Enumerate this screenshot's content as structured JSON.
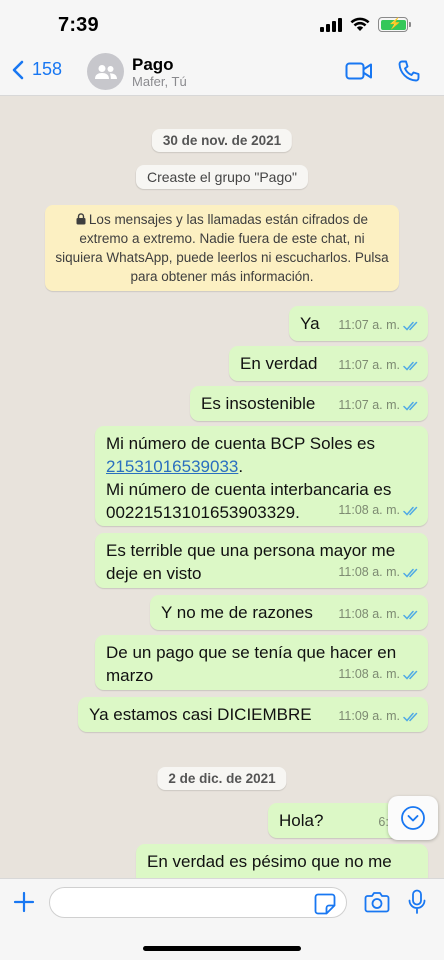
{
  "status": {
    "time": "7:39"
  },
  "header": {
    "back_count": "158",
    "title": "Pago",
    "subtitle": "Mafer, Tú"
  },
  "chat": {
    "date_1": "30 de nov. de 2021",
    "system_created": "Creaste el grupo \"Pago\"",
    "encryption_notice": "Los mensajes y las llamadas están cifrados de extremo a extremo. Nadie fuera de este chat, ni siquiera WhatsApp, puede leerlos ni escucharlos. Pulsa para obtener más información.",
    "messages": [
      {
        "text": "Ya",
        "time": "11:07 a. m."
      },
      {
        "text": "En verdad",
        "time": "11:07 a. m."
      },
      {
        "text": "Es insostenible",
        "time": "11:07 a. m."
      },
      {
        "line1": "Mi número de cuenta BCP Soles es",
        "link": "21531016539033",
        "line2_suffix": ".",
        "line3": "Mi número de cuenta interbancaria es",
        "line4": "00221513101653903329.",
        "time": "11:08 a. m."
      },
      {
        "text": "Es terrible que una persona mayor me deje en visto",
        "time": "11:08 a. m."
      },
      {
        "text": "Y no me de razones",
        "time": "11:08 a. m."
      },
      {
        "text": "De un pago que se tenía que hacer en marzo",
        "time": "11:08 a. m."
      },
      {
        "text": "Ya estamos casi DICIEMBRE",
        "time": "11:09 a. m."
      },
      {
        "text": "Hola?",
        "time": "6:13 p. m."
      },
      {
        "text": "En verdad es pésimo que no me",
        "time": ""
      }
    ],
    "date_2": "2 de dic. de 2021"
  },
  "input": {
    "placeholder": "",
    "value": ""
  },
  "colors": {
    "accent": "#1877f2",
    "outgoing_bubble": "#dcf8c6",
    "read_ticks": "#4fa9e5",
    "notice_bg": "#fcf0c2"
  }
}
